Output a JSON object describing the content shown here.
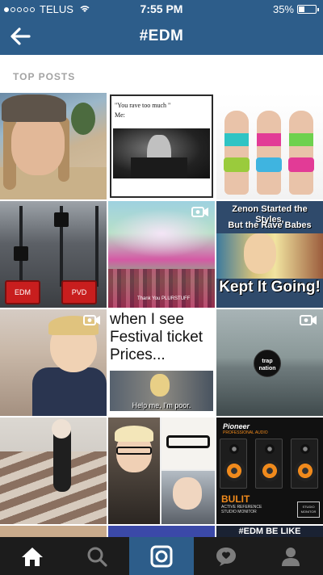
{
  "status_bar": {
    "carrier": "TELUS",
    "time": "7:55 PM",
    "battery": "35%",
    "battery_level": 0.35
  },
  "header": {
    "title": "#EDM",
    "back_icon": "back-arrow-icon"
  },
  "section": {
    "label": "TOP POSTS"
  },
  "posts": {
    "meme_line1": "\"You rave too much \"",
    "meme_line2": "Me:",
    "fader_labels": [
      "EDM",
      "PVD"
    ],
    "photo_caption": "Thank You PLURSTUFF",
    "zenon_line1": "Zenon Started the Styles,",
    "zenon_line2": "But the Rave Babes",
    "zenon_line3": "Kept It Going!",
    "festival_line1": "when I see",
    "festival_line2": "Festival ticket",
    "festival_line3": "Prices...",
    "festival_caption": "Help me, I'm poor.",
    "trap_logo": "trap nation",
    "pioneer_brand": "Pioneer",
    "pioneer_sub": "PROFESSIONAL AUDIO",
    "bulit": "BULIT",
    "bulit_desc1": "ACTIVE REFERENCE",
    "bulit_desc2": "STUDIO MONITOR",
    "monitor_label": "STUDIO MONITOR",
    "edm_caption": "#EDM BE LIKE"
  },
  "tabs": [
    {
      "name": "home",
      "icon": "home-icon"
    },
    {
      "name": "explore",
      "icon": "search-icon"
    },
    {
      "name": "camera",
      "icon": "camera-icon",
      "active": true
    },
    {
      "name": "activity",
      "icon": "activity-bubble-icon"
    },
    {
      "name": "profile",
      "icon": "profile-icon"
    }
  ],
  "colors": {
    "header_bg": "#2d5d8a",
    "tabbar_bg": "#1c1c1c",
    "active_tab": "#2d5d8a",
    "section_label": "#a3a3a3"
  }
}
